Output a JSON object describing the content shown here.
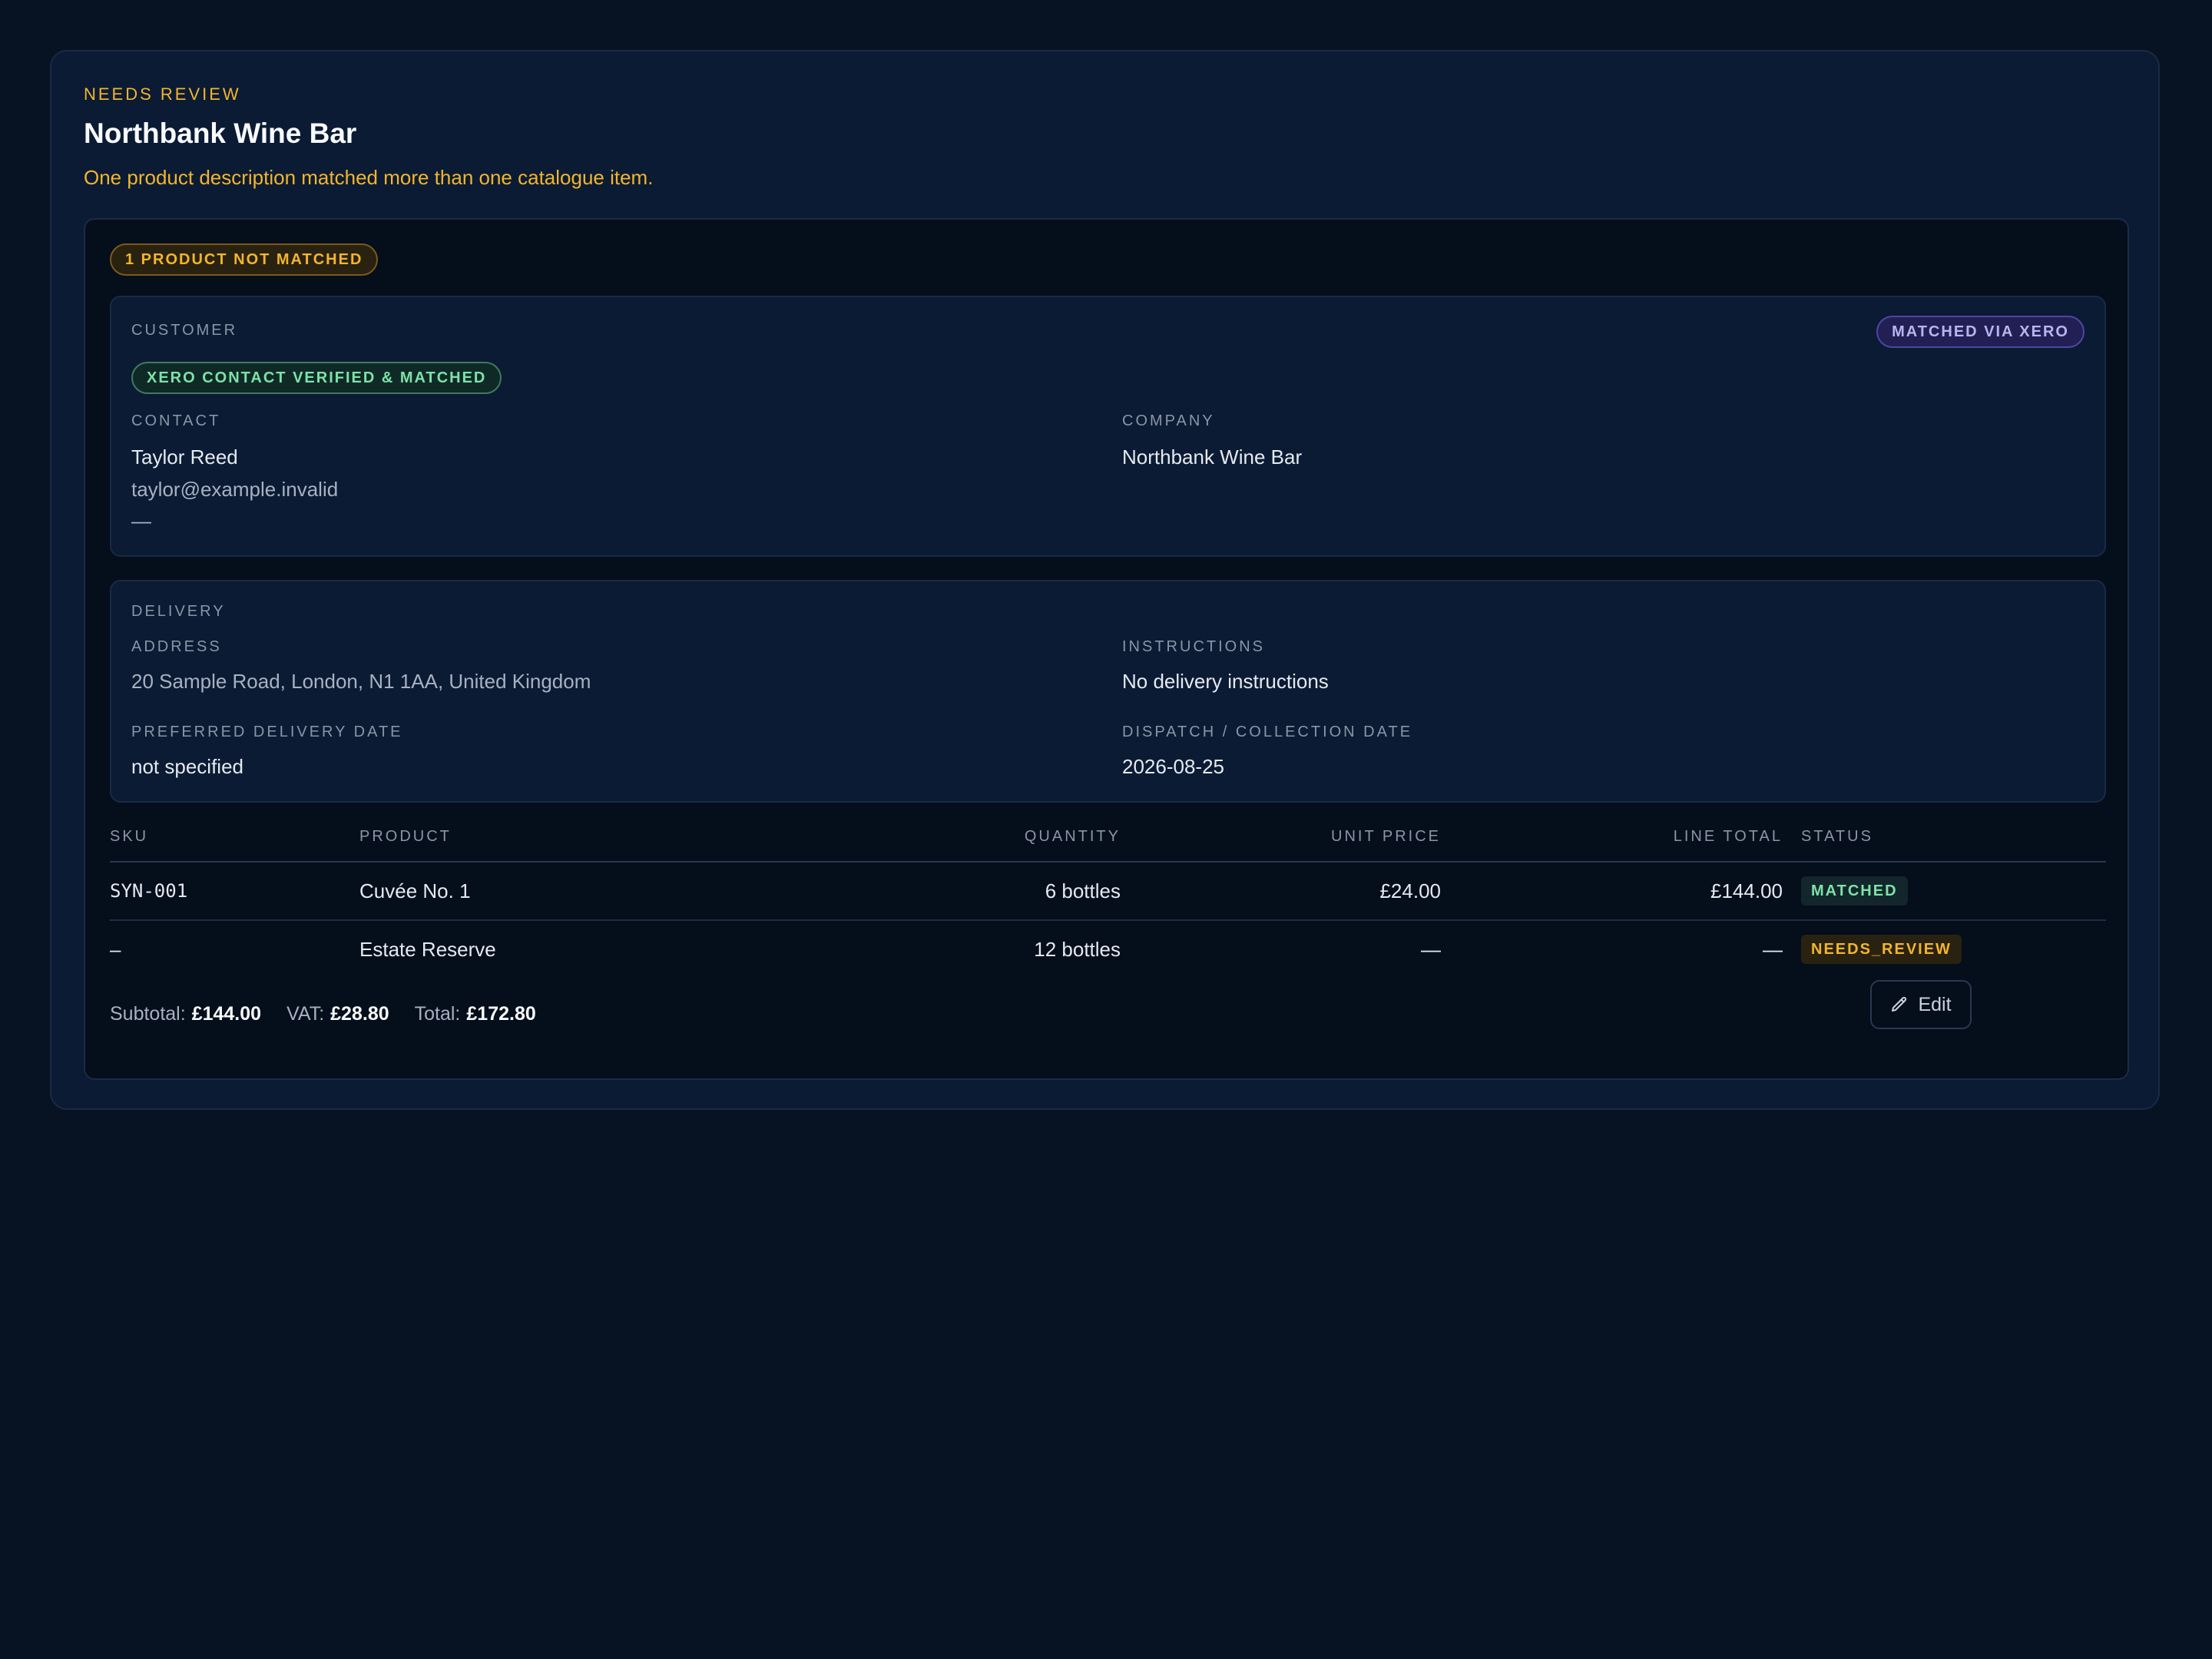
{
  "order": {
    "status_eyebrow": "NEEDS REVIEW",
    "customer_name": "Northbank Wine Bar",
    "review_reason": "One product description matched more than one catalogue item.",
    "unmatched_badge": "1 PRODUCT NOT MATCHED"
  },
  "customer": {
    "section_label": "CUSTOMER",
    "match_source_badge": "MATCHED VIA XERO",
    "verified_badge": "XERO CONTACT VERIFIED & MATCHED",
    "contact_label": "CONTACT",
    "contact_name": "Taylor Reed",
    "contact_email": "taylor@example.invalid",
    "contact_phone": "—",
    "company_label": "COMPANY",
    "company_name": "Northbank Wine Bar"
  },
  "delivery": {
    "section_label": "DELIVERY",
    "address_label": "ADDRESS",
    "address": "20 Sample Road, London, N1 1AA, United Kingdom",
    "instructions_label": "INSTRUCTIONS",
    "instructions": "No delivery instructions",
    "preferred_date_label": "PREFERRED DELIVERY DATE",
    "preferred_date": "not specified",
    "dispatch_date_label": "DISPATCH / COLLECTION DATE",
    "dispatch_date": "2026-08-25"
  },
  "table": {
    "headers": {
      "sku": "SKU",
      "product": "PRODUCT",
      "quantity": "QUANTITY",
      "unit_price": "UNIT PRICE",
      "line_total": "LINE TOTAL",
      "status": "STATUS"
    },
    "rows": [
      {
        "sku": "SYN-001",
        "product": "Cuvée No. 1",
        "quantity": "6 bottles",
        "unit_price": "£24.00",
        "line_total": "£144.00",
        "status": "MATCHED"
      },
      {
        "sku": "–",
        "product": "Estate Reserve",
        "quantity": "12 bottles",
        "unit_price": "—",
        "line_total": "—",
        "status": "NEEDS_REVIEW"
      }
    ]
  },
  "totals": {
    "subtotal_label": "Subtotal:",
    "subtotal": "£144.00",
    "vat_label": "VAT:",
    "vat": "£28.80",
    "total_label": "Total:",
    "total": "£172.80"
  },
  "actions": {
    "edit_label": "Edit",
    "edit_icon": "pencil-icon"
  },
  "colors": {
    "background": "#071222",
    "card": "#0b1b34",
    "warning": "#f2b52e",
    "success": "#7ee2a8",
    "accent_purple": "#b9b4ef"
  }
}
